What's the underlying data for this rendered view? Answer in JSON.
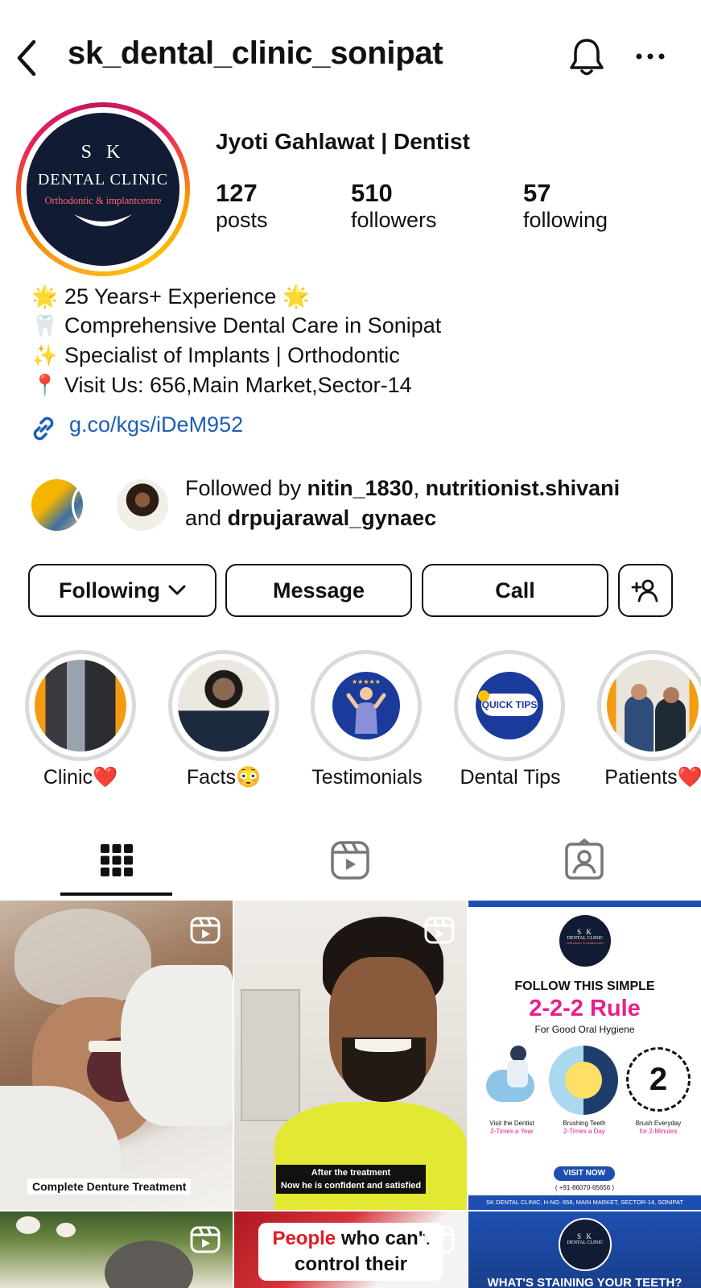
{
  "header": {
    "username": "sk_dental_clinic_sonipat"
  },
  "profile": {
    "logo": {
      "line1": "S K",
      "line2": "DENTAL CLINIC",
      "line3": "Orthodontic & implantcentre"
    },
    "display_name": "Jyoti Gahlawat | Dentist",
    "stats": {
      "posts": {
        "value": "127",
        "label": "posts"
      },
      "followers": {
        "value": "510",
        "label": "followers"
      },
      "following": {
        "value": "57",
        "label": "following"
      }
    },
    "bio": [
      {
        "emoji": "🌟",
        "text": "25 Years+ Experience 🌟"
      },
      {
        "emoji": "🦷",
        "text": "Comprehensive Dental Care in Sonipat"
      },
      {
        "emoji": "✨",
        "text": "Specialist of Implants | Orthodontic"
      },
      {
        "emoji": "📍",
        "text": "Visit Us: 656,Main Market,Sector-14"
      }
    ],
    "link": "g.co/kgs/iDeM952",
    "followed_by": {
      "prefix": "Followed by ",
      "user1": "nitin_1830",
      "sep": ", ",
      "user2": "nutritionist.shivani",
      "and": "and ",
      "user3": "drpujarawal_gynaec"
    }
  },
  "actions": {
    "following": "Following",
    "message": "Message",
    "call": "Call"
  },
  "highlights": [
    {
      "label": "Clinic❤️"
    },
    {
      "label": "Facts😳"
    },
    {
      "label": "Testimonials"
    },
    {
      "label": "Dental Tips",
      "badge": "QUICK TIPS"
    },
    {
      "label": "Patients❤️"
    }
  ],
  "posts": {
    "p1": {
      "caption": "Complete Denture Treatment"
    },
    "p2": {
      "caption_l1": "After the treatment",
      "caption_l2": "Now he is confident and satisfied"
    },
    "p3": {
      "logo1": "S K",
      "logo2": "DENTAL CLINIC",
      "logo3": "Orthodontic & implantcentre",
      "heading": "FOLLOW THIS SIMPLE",
      "rule": "2-2-2 Rule",
      "sub": "For Good Oral Hygiene",
      "num": "2",
      "c1a": "Visit the Dentist",
      "c1b": "2-Times a Year",
      "c2a": "Brushing Teeth",
      "c2b": "2-Times a Day",
      "c3a": "Brush Everyday",
      "c3b": "for 2-Minutes",
      "visit": "VISIT NOW",
      "phone": "( +91-86070-65656 )",
      "address": "SK DENTAL CLINIC, H-NO. 656, MAIN MARKET, SECTOR-14, SONIPAT"
    },
    "p5": {
      "line1_red": "People",
      "line1_rest": " who can't",
      "line2": "control their"
    },
    "p6": {
      "logo1": "S K",
      "logo2": "DENTAL CLINIC",
      "heading": "WHAT'S STAINING YOUR TEETH?"
    }
  },
  "colors": {
    "link": "#1a5fb4",
    "rule": "#e91e8c",
    "brand_navy": "#111b33",
    "post_blue": "#1d4fb0"
  }
}
